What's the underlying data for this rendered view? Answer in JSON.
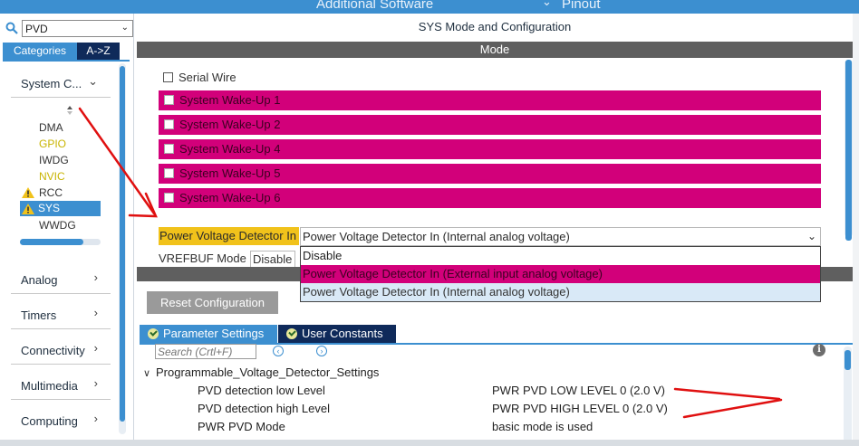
{
  "topbar": {
    "tab_additional": "Additional Software",
    "tab_pinout": "Pinout",
    "accent_color": "#3c8fd0"
  },
  "left": {
    "search_value": "PVD",
    "tab_categories": "Categories",
    "tab_az": "A->Z",
    "groups": {
      "system_core": "System C...",
      "analog": "Analog",
      "timers": "Timers",
      "connectivity": "Connectivity",
      "multimedia": "Multimedia",
      "computing": "Computing"
    },
    "items": [
      "DMA",
      "GPIO",
      "IWDG",
      "NVIC",
      "RCC",
      "SYS",
      "WWDG"
    ],
    "selected_item": "SYS",
    "warning_items": [
      "RCC",
      "SYS"
    ],
    "yellow_items": [
      "GPIO",
      "NVIC"
    ]
  },
  "main": {
    "title": "SYS Mode and Configuration",
    "mode_header": "Mode",
    "serial_wire": "Serial Wire",
    "wakeups": [
      "System Wake-Up 1",
      "System Wake-Up 2",
      "System Wake-Up 4",
      "System Wake-Up 5",
      "System Wake-Up 6"
    ],
    "pvd_label": "Power Voltage Detector In",
    "pvd_value": "Power Voltage Detector In (Internal analog voltage)",
    "vrefbuf_label": "VREFBUF Mode",
    "vrefbuf_value": "Disable",
    "dropdown_options": [
      "Disable",
      "Power Voltage Detector In (External input analog voltage)",
      "Power Voltage Detector In (Internal analog voltage)"
    ],
    "highlight_color": "#d2007a",
    "label_highlight_color": "#f1c21b"
  },
  "config": {
    "reset_button": "Reset Configuration",
    "tab_parameter": "Parameter Settings",
    "tab_user": "User Constants",
    "search_placeholder": "Search (Crtl+F)",
    "group_name": "Programmable_Voltage_Detector_Settings",
    "params": [
      {
        "name": "PVD detection low Level",
        "value": "PWR PVD LOW LEVEL 0 (2.0 V)"
      },
      {
        "name": "PVD detection high Level",
        "value": "PWR PVD HIGH LEVEL 0 (2.0 V)"
      },
      {
        "name": "PWR PVD Mode",
        "value": "basic mode is used"
      }
    ]
  },
  "annotation_color": "#e01010"
}
